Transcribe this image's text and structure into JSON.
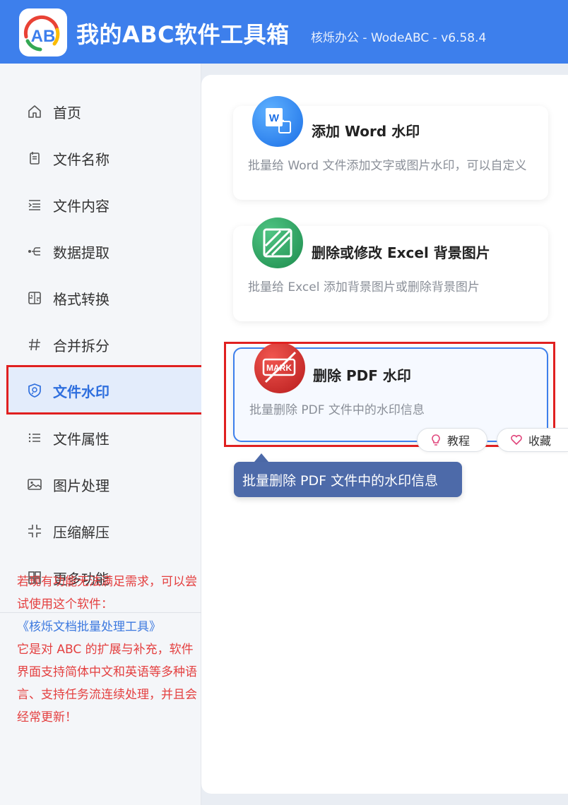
{
  "header": {
    "title": "我的ABC软件工具箱",
    "subtitle": "核烁办公 - WodeABC - v6.58.4",
    "logo_text": "AB"
  },
  "sidebar": {
    "items": [
      {
        "label": "首页",
        "icon": "home-icon"
      },
      {
        "label": "文件名称",
        "icon": "file-name-icon"
      },
      {
        "label": "文件内容",
        "icon": "file-content-icon"
      },
      {
        "label": "数据提取",
        "icon": "data-extract-icon"
      },
      {
        "label": "格式转换",
        "icon": "format-convert-icon"
      },
      {
        "label": "合并拆分",
        "icon": "hash-icon"
      },
      {
        "label": "文件水印",
        "icon": "watermark-shield-icon",
        "active": true
      },
      {
        "label": "文件属性",
        "icon": "list-icon"
      },
      {
        "label": "图片处理",
        "icon": "image-icon"
      },
      {
        "label": "压缩解压",
        "icon": "compress-icon"
      },
      {
        "label": "更多功能",
        "icon": "grid-icon"
      }
    ],
    "promo": {
      "line1": "若现有功能无法满足需求，可以尝试使用这个软件：",
      "link": "《核烁文档批量处理工具》",
      "line2": "它是对 ABC 的扩展与补充，软件界面支持简体中文和英语等多种语言、支持任务流连续处理，并且会经常更新！"
    }
  },
  "cards": [
    {
      "title": "添加 Word 水印",
      "desc": "批量给 Word 文件添加文字或图片水印，可以自定义",
      "icon": "word-watermark-icon"
    },
    {
      "title": "删除或修改 Excel 背景图片",
      "desc": "批量给 Excel 添加背景图片或删除背景图片",
      "icon": "excel-background-icon"
    },
    {
      "title": "删除 PDF 水印",
      "desc": "批量删除 PDF 文件中的水印信息",
      "icon": "pdf-watermark-remove-icon",
      "icon_text": "MARK"
    }
  ],
  "actions": {
    "tutorial": "教程",
    "favorite": "收藏"
  },
  "tooltip": "批量删除 PDF 文件中的水印信息",
  "colors": {
    "header": "#3d7fec",
    "active": "#2f6fde",
    "highlight": "#e02020",
    "tooltip": "#4d6aa9"
  }
}
